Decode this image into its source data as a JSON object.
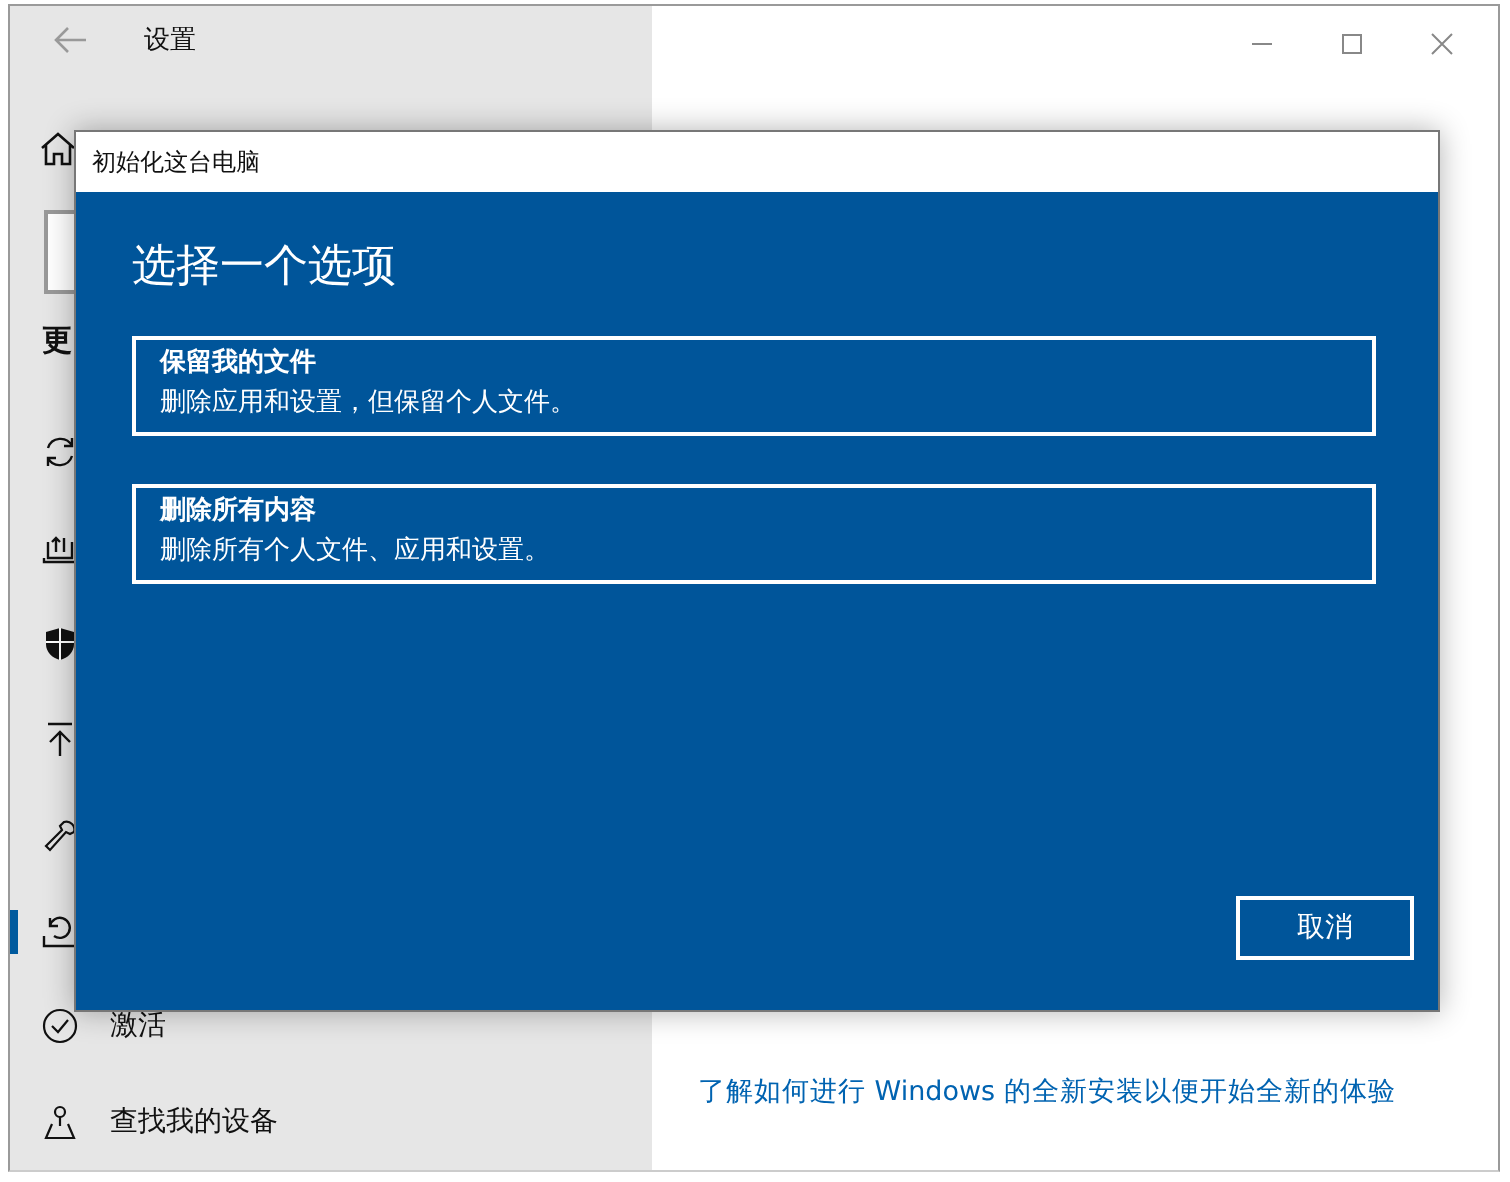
{
  "settings_window": {
    "title": "设置",
    "sidebar": {
      "heading": "更",
      "items": [
        {
          "selected": false
        },
        {
          "selected": false
        },
        {
          "selected": false
        },
        {
          "selected": false
        },
        {
          "selected": false
        },
        {
          "selected": true
        },
        {
          "label": "激活",
          "selected": false
        },
        {
          "label": "查找我的设备",
          "selected": false
        }
      ]
    },
    "link": "了解如何进行 Windows 的全新安装以便开始全新的体验"
  },
  "dialog": {
    "title": "初始化这台电脑",
    "heading": "选择一个选项",
    "options": [
      {
        "title": "保留我的文件",
        "description": "删除应用和设置，但保留个人文件。"
      },
      {
        "title": "删除所有内容",
        "description": "删除所有个人文件、应用和设置。"
      }
    ],
    "cancel": "取消"
  }
}
